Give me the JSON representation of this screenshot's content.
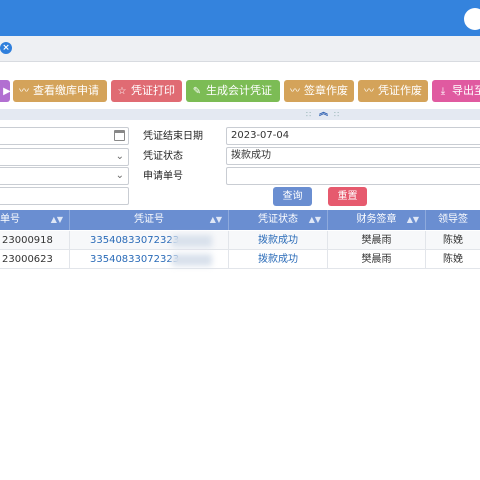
{
  "toolbar": {
    "buttons": [
      {
        "label": "查看缴库申请",
        "icon": "activity-icon",
        "color": "#d4a35a"
      },
      {
        "label": "凭证打印",
        "icon": "star-icon",
        "color": "#e06b73"
      },
      {
        "label": "生成会计凭证",
        "icon": "edit-icon",
        "color": "#7cbc55"
      },
      {
        "label": "签章作废",
        "icon": "activity-icon",
        "color": "#d4a35a"
      },
      {
        "label": "凭证作废",
        "icon": "activity-icon",
        "color": "#d4a35a"
      },
      {
        "label": "导出至",
        "icon": "download-icon",
        "color": "#e05aa0"
      }
    ],
    "first_color": "#b26fd1"
  },
  "search": {
    "end_date_label": "凭证结束日期",
    "end_date_value": "2023-07-04",
    "status_label": "凭证状态",
    "status_value": "拨款成功",
    "apply_no_label": "申请单号",
    "apply_no_value": "",
    "query_label": "查询",
    "reset_label": "重置"
  },
  "grid": {
    "columns": [
      "单号",
      "凭证号",
      "凭证状态",
      "财务签章",
      "领导签"
    ],
    "rows": [
      {
        "order_no": "23000918",
        "voucher_no": "33540833072323",
        "status": "拨款成功",
        "finance_sign": "樊晨雨",
        "leader_sign": "陈娩"
      },
      {
        "order_no": "23000623",
        "voucher_no": "33540833072323",
        "status": "拨款成功",
        "finance_sign": "樊晨雨",
        "leader_sign": "陈娩"
      }
    ]
  }
}
